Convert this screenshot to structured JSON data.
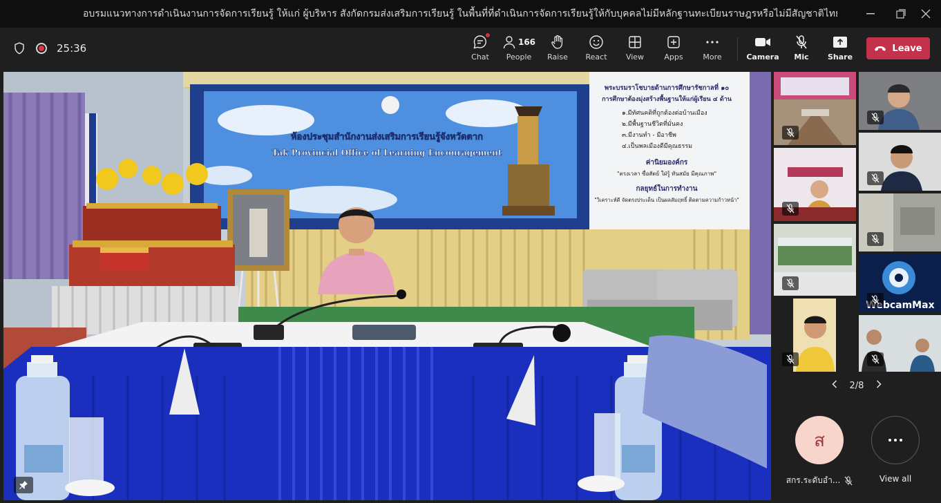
{
  "window": {
    "title": "อบรมแนวทางการดำเนินงานการจัดการเรียนรู้ ให้แก่ ผู้บริหาร สังกัดกรมส่งเสริมการเรียนรู้ ในพื้นที่ที่ดำเนินการจัดการเรียนรู้ให้กับบุคคลไม่มีหลักฐานทะเบียนราษฎรหรือไม่มีสัญชาติไทย"
  },
  "status": {
    "timer": "25:36"
  },
  "toolbar": {
    "chat": "Chat",
    "people": "People",
    "people_count": "166",
    "raise": "Raise",
    "react": "React",
    "view": "View",
    "apps": "Apps",
    "more": "More",
    "camera": "Camera",
    "mic": "Mic",
    "share": "Share",
    "leave": "Leave"
  },
  "stage": {
    "banner_th": "ห้องประชุมสำนักงานส่งเสริมการเรียนรู้จังหวัดตาก",
    "banner_en": "Tak Provincial Office of Learning Encouragement",
    "policy_title": "พระบรมราโชบายด้านการศึกษารัชกาลที่ ๑๐",
    "policy_sub": "การศึกษาต้องมุ่งสร้างพื้นฐานให้แก่ผู้เรียน ๔ ด้าน",
    "policy_items": [
      "๑.มีทัศนคติที่ถูกต้องต่อบ้านเมือง",
      "๒.มีพื้นฐานชีวิตที่มั่นคง",
      "๓.มีงานทำ - มีอาชีพ",
      "๔.เป็นพลเมืองดีมีคุณธรรม"
    ],
    "values_title": "ค่านิยมองค์กร",
    "values_text": "\"ตรงเวลา ซื่อสัตย์ ใฝ่รู้ ทันสมัย มีคุณภาพ\"",
    "strategy_title": "กลยุทธ์ในการทำงาน",
    "strategy_text": "\"วิเคราะห์ดี จัดตรงประเด็น เป็นผลสัมฤทธิ์ ติดตามความก้าวหน้า\""
  },
  "tiles": {
    "webcam_text": "WebcamMax"
  },
  "pager": {
    "label": "2/8"
  },
  "participants": {
    "user_initial": "ส",
    "user_name": "สกร.ระดับอำ...",
    "view_all": "View all"
  },
  "colors": {
    "leave": "#c4314b",
    "rec": "#e2373f",
    "avatar_bg": "#f8d5cc"
  }
}
